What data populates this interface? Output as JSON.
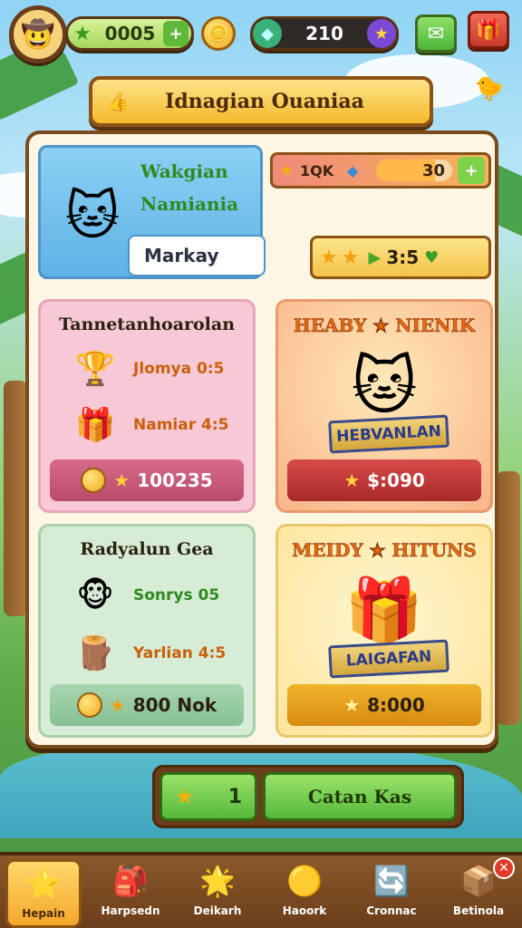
{
  "hud": {
    "avatar_icon": "🤠",
    "currency1_value": "0005",
    "currency1_icon": "★",
    "currency1_plus": "+",
    "coin_icon": "🪙",
    "currency2_value": "210",
    "currency2_icon": "◆",
    "currency2_badge": "★",
    "mail_icon": "✉",
    "gift_icon": "🎁",
    "side_icon": "🐤"
  },
  "banner": {
    "icon": "👍",
    "title": "Idnagian Ouaniaa"
  },
  "profile": {
    "pet_icon": "🐱",
    "name_line1": "Wakgian",
    "name_line2": "Namiania",
    "nickname": "Markay"
  },
  "xp_bar": {
    "star": "★",
    "label": "1QK",
    "gem": "◆",
    "value": "30",
    "plus": "+",
    "fill": 0.78
  },
  "rating": {
    "stars": [
      "★",
      "★"
    ],
    "play": "▶",
    "value": "3:5",
    "heart": "♥"
  },
  "cards": [
    {
      "title": "Tannetanhoarolan",
      "rows": [
        {
          "icon": "🏆",
          "text": "Jlomya 0:5"
        },
        {
          "icon": "🎁",
          "text": "Namiar 4:5"
        }
      ],
      "price": "100235"
    },
    {
      "title": "HEABY ★ NIENIK",
      "ribbon": "HEBVANLAN",
      "mascot": "🐱",
      "price": "$:090"
    },
    {
      "title": "Radyalun Gea",
      "rows": [
        {
          "icon": "🐵",
          "text": "Sonrys 05"
        },
        {
          "icon": "🪵",
          "text": "Yarlian 4:5"
        }
      ],
      "price": "800 Nok"
    },
    {
      "title": "MEIDY ★ HITUNS",
      "ribbon": "LAIGAFAN",
      "mascot": "🎁",
      "price": "8:000"
    }
  ],
  "action_bar": {
    "count": "1",
    "star": "★",
    "button_label": "Catan Kas"
  },
  "bottom_nav": [
    {
      "icon": "⭐",
      "label": "Hepain",
      "active": true
    },
    {
      "icon": "🎒",
      "label": "Harpsedn",
      "active": false
    },
    {
      "icon": "🌟",
      "label": "Deikarh",
      "active": false
    },
    {
      "icon": "🟡",
      "label": "Haoork",
      "active": false
    },
    {
      "icon": "🔄",
      "label": "Cronnac",
      "active": false
    },
    {
      "icon": "📦",
      "label": "Betinola",
      "active": false,
      "badge": "✕"
    }
  ],
  "colors": {
    "brown_border": "#7a4a1c",
    "panel_bg": "#fdf6e4",
    "banner_yellow": "#f4b92a",
    "green_button": "#56b83a",
    "pink_card": "#f7c8d6",
    "orange_card": "#f9c49a",
    "mint_card": "#d6ecd6",
    "yellow_card": "#fdeaa8"
  }
}
